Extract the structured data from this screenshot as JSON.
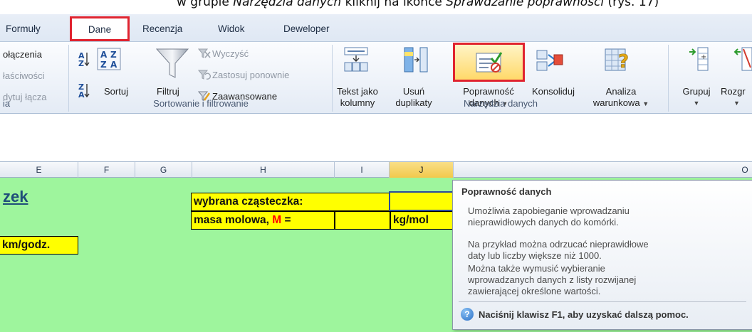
{
  "caption": {
    "before": "w grupie ",
    "group_italic": "Narzędzia danych",
    "middle": " kliknij na ikonce ",
    "icon_italic": "Sprawdzanie poprawności",
    "after": " (rys. 17)"
  },
  "tabs": [
    "Formuły",
    "Dane",
    "Recenzja",
    "Widok",
    "Deweloper"
  ],
  "ribbon": {
    "connections": {
      "items": [
        "ołączenia",
        "łaściwości",
        "dytuj łącza"
      ],
      "group_label": "ia"
    },
    "sort_filter": {
      "sort_label": "Sortuj",
      "filter_label": "Filtruj",
      "clear_label": "Wyczyść",
      "reapply_label": "Zastosuj ponownie",
      "advanced_label": "Zaawansowane",
      "group_label": "Sortowanie i filtrowanie"
    },
    "data_tools": {
      "text_to_columns": [
        "Tekst jako",
        "kolumny"
      ],
      "remove_duplicates": [
        "Usuń",
        "duplikaty"
      ],
      "data_validation": [
        "Poprawność",
        "danych"
      ],
      "consolidate": "Konsoliduj",
      "what_if": [
        "Analiza",
        "warunkowa"
      ],
      "group_label": "Narzędzia danych"
    },
    "outline": {
      "group_label": "Grupuj",
      "ungroup_label": "Rozgr"
    }
  },
  "columns": [
    "E",
    "F",
    "G",
    "H",
    "I",
    "J",
    "O"
  ],
  "sheet": {
    "title_fragment": "zek",
    "selected_molecule_label": "wybrana cząsteczka:",
    "molar_mass_label": "masa molowa, ",
    "molar_mass_symbol": "M",
    "molar_mass_eq": " =",
    "unit_kg_mol": "kg/mol",
    "unit_speed": "km/godz."
  },
  "tooltip": {
    "title": "Poprawność danych",
    "paragraphs": [
      [
        "Umożliwia zapobieganie wprowadzaniu",
        "nieprawidłowych danych do komórki."
      ],
      [
        "Na przykład można odrzucać nieprawidłowe",
        "daty lub liczby większe niż 1000."
      ],
      [
        "Można także wymusić wybieranie",
        "wprowadzanych danych z listy rozwijanej",
        "zawierającej określone wartości."
      ]
    ],
    "help_text": "Naciśnij klawisz F1, aby uzyskać dalszą pomoc."
  },
  "colors": {
    "highlight_red": "#e0232f",
    "sheet_green": "#9ef59d",
    "cell_yellow": "#ffff00",
    "symbol_red": "#ff0000",
    "title_blue": "#1f4e79"
  }
}
